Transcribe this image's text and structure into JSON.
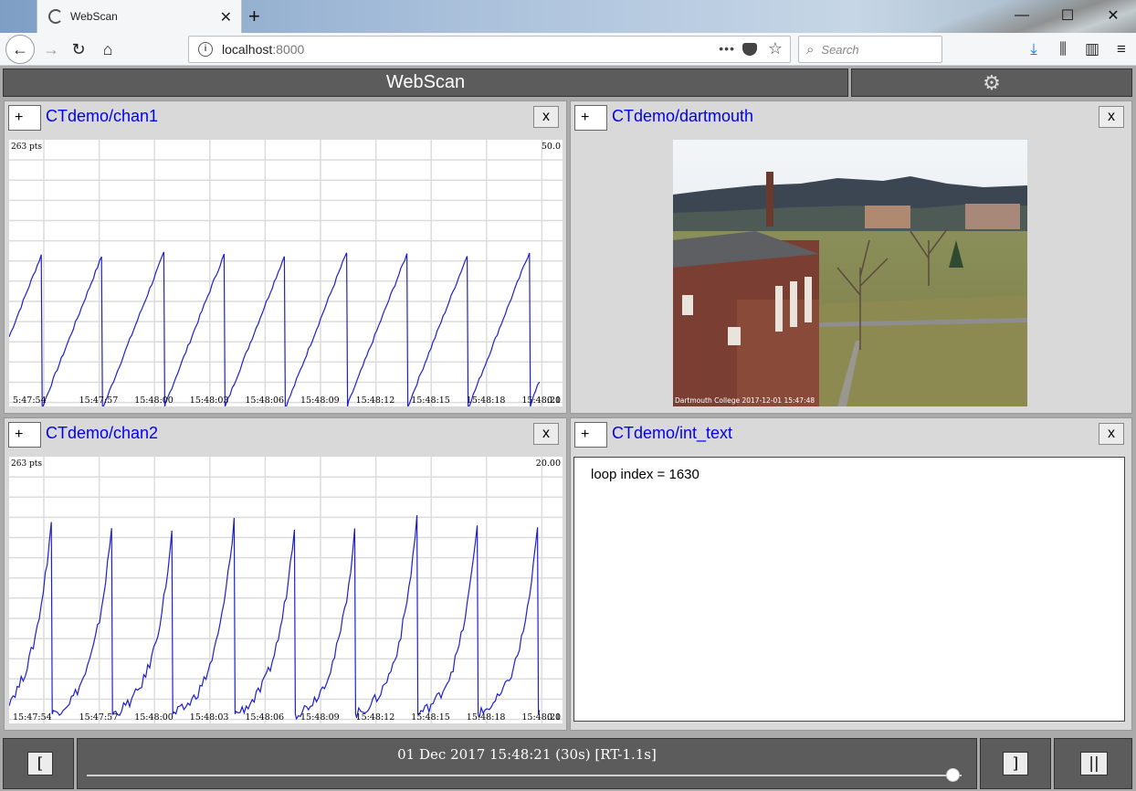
{
  "browser": {
    "tab_title": "WebScan",
    "url_host": "localhost",
    "url_port": ":8000",
    "search_placeholder": "Search"
  },
  "app": {
    "title": "WebScan"
  },
  "panels": {
    "chan1": {
      "title": "CTdemo/chan1",
      "add_label": "+",
      "close_label": "x",
      "pts_label": "263 pts",
      "ymax_label": "50.0",
      "ymin_label": "0.0",
      "xticks": [
        "5:47:54",
        "15:47:57",
        "15:48:00",
        "15:48:03",
        "15:48:06",
        "15:48:09",
        "15:48:12",
        "15:48:15",
        "15:48:18",
        "15:48:21"
      ]
    },
    "dartmouth": {
      "title": "CTdemo/dartmouth",
      "add_label": "+",
      "close_label": "x",
      "caption": "Dartmouth College 2017-12-01 15:47:48"
    },
    "chan2": {
      "title": "CTdemo/chan2",
      "add_label": "+",
      "close_label": "x",
      "pts_label": "263 pts",
      "ymax_label": "20.00",
      "ymin_label": "0.0",
      "xticks": [
        "15:47:54",
        "15:47:57",
        "15:48:00",
        "15:48:03",
        "15:48:06",
        "15:48:09",
        "15:48:12",
        "15:48:15",
        "15:48:18",
        "15:48:21"
      ]
    },
    "int_text": {
      "title": "CTdemo/int_text",
      "add_label": "+",
      "close_label": "x",
      "text": "loop index = 1630"
    }
  },
  "footer": {
    "left_bracket": "[",
    "right_bracket": "]",
    "pause_label": "||",
    "timestamp": "01 Dec 2017 15:48:21 (30s) [RT-1.1s]",
    "slider_fraction": 0.99
  },
  "chart_data": [
    {
      "type": "line",
      "name": "CTdemo/chan1",
      "ylim": [
        0,
        50
      ],
      "x": [
        "15:47:54",
        "15:47:57",
        "15:48:00",
        "15:48:03",
        "15:48:06",
        "15:48:09",
        "15:48:12",
        "15:48:15",
        "15:48:18",
        "15:48:21"
      ],
      "pattern": "sawtooth",
      "period_s": 3.3,
      "peak": 29,
      "trough": 0,
      "grid": true
    },
    {
      "type": "line",
      "name": "CTdemo/chan2",
      "ylim": [
        0,
        20
      ],
      "x": [
        "15:47:54",
        "15:47:57",
        "15:48:00",
        "15:48:03",
        "15:48:06",
        "15:48:09",
        "15:48:12",
        "15:48:15",
        "15:48:18",
        "15:48:21"
      ],
      "pattern": "exponential-sawtooth",
      "period_s": 3.3,
      "peak": 15.5,
      "trough": 0.7,
      "grid": true
    }
  ]
}
